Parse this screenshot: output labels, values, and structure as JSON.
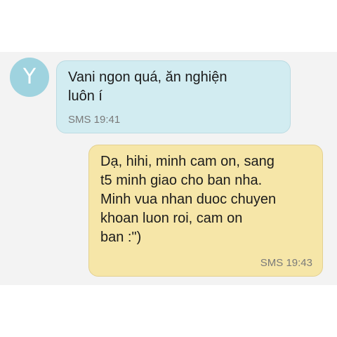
{
  "conversation": {
    "avatar_letter": "Y",
    "messages": [
      {
        "direction": "incoming",
        "text": "Vani ngon quá, ăn nghiện\nluôn í",
        "meta": "SMS 19:41"
      },
      {
        "direction": "outgoing",
        "text": "Dạ, hihi, minh cam on, sang\nt5 minh giao cho ban nha.\nMinh vua nhan duoc chuyen\nkhoan luon roi, cam on\nban :\")",
        "meta": "SMS 19:43"
      }
    ]
  },
  "colors": {
    "incoming_bubble": "#d2ecf1",
    "outgoing_bubble": "#f6e6a8",
    "avatar": "#9fd3df",
    "background": "#f3f3f3"
  }
}
